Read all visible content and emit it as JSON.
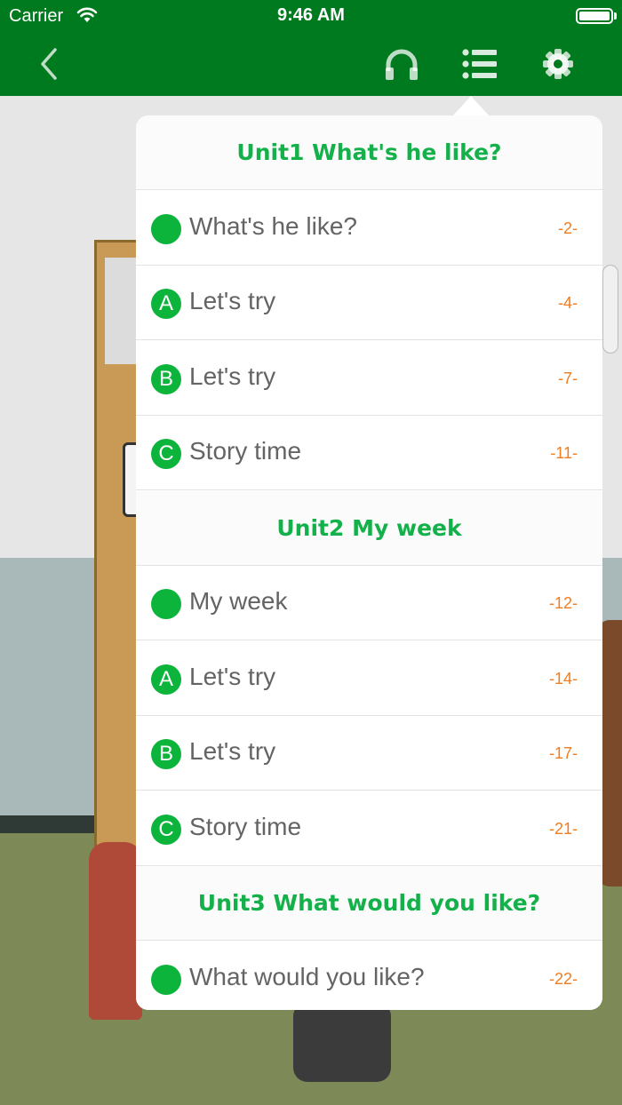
{
  "status_bar": {
    "carrier": "Carrier",
    "time": "9:46 AM"
  },
  "nav": {
    "back_icon": "chevron-left-icon",
    "audio_icon": "headphones-icon",
    "list_icon": "list-icon",
    "settings_icon": "gear-icon"
  },
  "colors": {
    "brand_green": "#007a1e",
    "section_title": "#14b14a",
    "badge": "#0cb43b",
    "page_number": "#f07d20"
  },
  "toc": {
    "units": [
      {
        "title": "Unit1 What's he like?",
        "items": [
          {
            "badge": "",
            "label": "What's he like?",
            "page": "-2-"
          },
          {
            "badge": "A",
            "label": "Let's try",
            "page": "-4-"
          },
          {
            "badge": "B",
            "label": "Let's try",
            "page": "-7-"
          },
          {
            "badge": "C",
            "label": "Story time",
            "page": "-11-"
          }
        ]
      },
      {
        "title": "Unit2 My week",
        "items": [
          {
            "badge": "",
            "label": "My week",
            "page": "-12-"
          },
          {
            "badge": "A",
            "label": "Let's try",
            "page": "-14-"
          },
          {
            "badge": "B",
            "label": "Let's try",
            "page": "-17-"
          },
          {
            "badge": "C",
            "label": "Story time",
            "page": "-21-"
          }
        ]
      },
      {
        "title": "Unit3 What would you like?",
        "items": [
          {
            "badge": "",
            "label": "What would you like?",
            "page": "-22-"
          }
        ]
      }
    ]
  }
}
